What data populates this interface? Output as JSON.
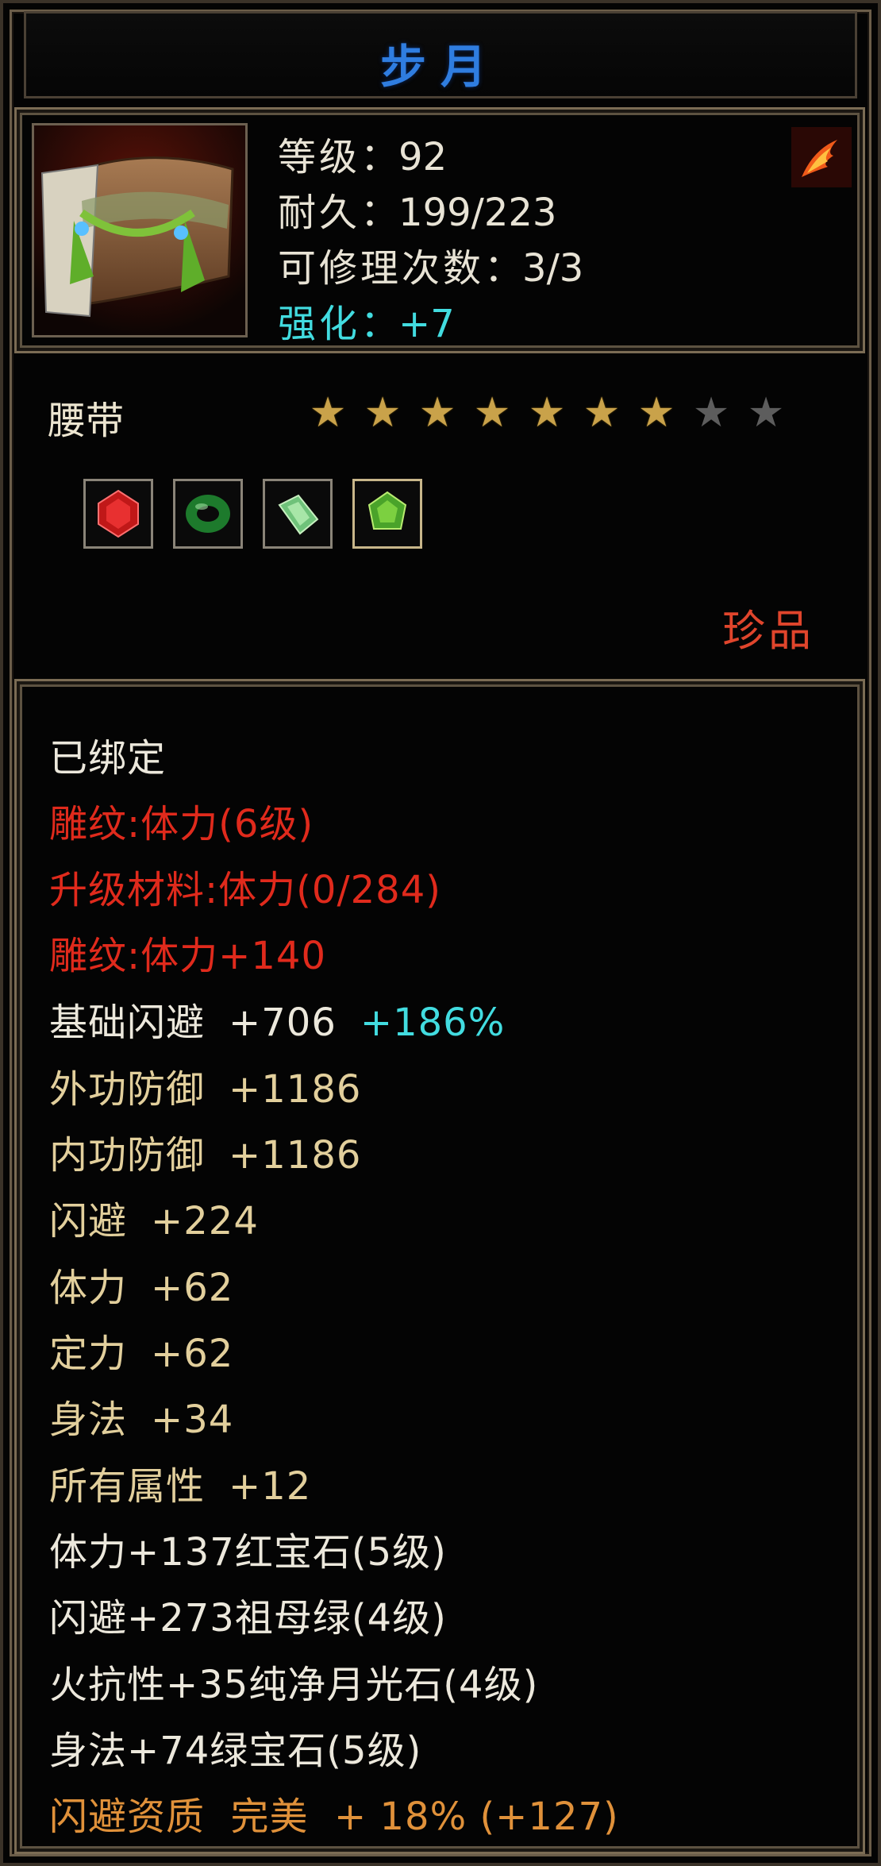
{
  "title": "步月",
  "stats": {
    "level_label": "等级",
    "level_value": "92",
    "durability_label": "耐久",
    "durability_value": "199/223",
    "repair_label": "可修理次数",
    "repair_value": "3/3",
    "enhance_label": "强化",
    "enhance_value": "+7",
    "sep": "："
  },
  "category": "腰带",
  "stars": {
    "filled": 7,
    "total": 9
  },
  "gem_icons": [
    "ruby-icon",
    "emerald-ring-icon",
    "moonstone-icon",
    "green-gem-icon"
  ],
  "rarity": "珍品",
  "lines": {
    "bound": "已绑定",
    "carving_level": "雕纹:体力(6级)",
    "upgrade_material": "升级材料:体力(0/284)",
    "carving_bonus": "雕纹:体力+140",
    "base_dodge_label": "基础闪避",
    "base_dodge_value": "+706",
    "base_dodge_pct": "+186%",
    "ext_def_label": "外功防御",
    "ext_def_value": "+1186",
    "int_def_label": "内功防御",
    "int_def_value": "+1186",
    "dodge_label": "闪避",
    "dodge_value": "+224",
    "stamina_label": "体力",
    "stamina_value": "+62",
    "focus_label": "定力",
    "focus_value": "+62",
    "agility_label": "身法",
    "agility_value": "+34",
    "all_label": "所有属性",
    "all_value": "+12",
    "gem1": "体力+137红宝石(5级)",
    "gem2": "闪避+273祖母绿(4级)",
    "gem3": "火抗性+35纯净月光石(4级)",
    "gem4": "身法+74绿宝石(5级)",
    "quality": "闪避资质  完美  + 18% (+127)"
  },
  "colors": {
    "title": "#2f7de0",
    "red": "#e02a1c",
    "tan": "#e2cf9c",
    "orange": "#e0913a",
    "cyan": "#42dce0"
  }
}
